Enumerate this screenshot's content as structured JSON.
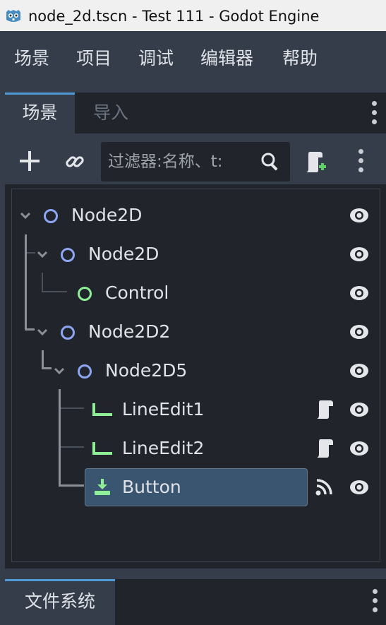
{
  "window": {
    "title": "node_2d.tscn - Test 111 - Godot Engine"
  },
  "menu": {
    "items": [
      "场景",
      "项目",
      "调试",
      "编辑器",
      "帮助"
    ]
  },
  "scene_dock": {
    "tabs": [
      "场景",
      "导入"
    ],
    "active_tab": "场景",
    "search": {
      "placeholder": "过滤器:名称、t:",
      "value": ""
    }
  },
  "tree": {
    "nodes": [
      {
        "label": "Node2D",
        "type": "Node2D",
        "expanded": true
      },
      {
        "label": "Node2D",
        "type": "Node2D",
        "expanded": true
      },
      {
        "label": "Control",
        "type": "Control"
      },
      {
        "label": "Node2D2",
        "type": "Node2D",
        "expanded": true
      },
      {
        "label": "Node2D5",
        "type": "Node2D",
        "expanded": true
      },
      {
        "label": "LineEdit1",
        "type": "LineEdit",
        "has_script": true
      },
      {
        "label": "LineEdit2",
        "type": "LineEdit",
        "has_script": true
      },
      {
        "label": "Button",
        "type": "Button",
        "has_signals": true,
        "selected": true
      }
    ]
  },
  "filesystem_dock": {
    "tab": "文件系统"
  },
  "colors": {
    "node2d": "#8da5f3",
    "control": "#8eef97",
    "accent": "#4e9ad6",
    "selection": "#3a5570"
  }
}
